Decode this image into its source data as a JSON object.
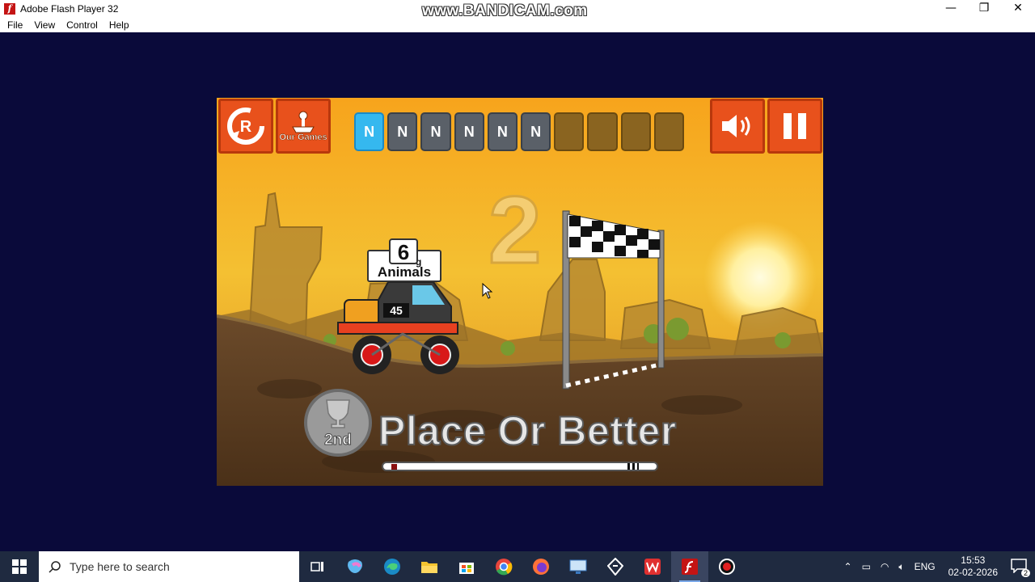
{
  "window": {
    "title": "Adobe Flash Player 32",
    "watermark": "www.BANDICAM.com",
    "controls": {
      "minimize": "—",
      "restore": "❐",
      "close": "✕"
    }
  },
  "menu": [
    "File",
    "View",
    "Control",
    "Help"
  ],
  "game": {
    "buttons": {
      "restart_letter": "R",
      "our_games": "Our Games",
      "sound": "sound-on",
      "pause": "pause"
    },
    "level_slots": [
      {
        "label": "N",
        "state": "active"
      },
      {
        "label": "N",
        "state": "done"
      },
      {
        "label": "N",
        "state": "done"
      },
      {
        "label": "N",
        "state": "done"
      },
      {
        "label": "N",
        "state": "done"
      },
      {
        "label": "N",
        "state": "done"
      },
      {
        "label": "",
        "state": "empty"
      },
      {
        "label": "",
        "state": "empty"
      },
      {
        "label": "",
        "state": "empty"
      },
      {
        "label": "",
        "state": "empty"
      }
    ],
    "countdown": "2",
    "animals_tag": {
      "count": "6",
      "under": "g",
      "label": "Animals"
    },
    "car_number": "45",
    "goal": {
      "place": "2nd",
      "text": "Place Or Better"
    },
    "race_progress": 0.02
  },
  "taskbar": {
    "search_placeholder": "Type here to search",
    "apps": [
      "task-view",
      "copilot",
      "edge",
      "file-explorer",
      "store",
      "chrome",
      "firefox",
      "remote-desktop",
      "vpn",
      "wps",
      "flash-player",
      "bandicam"
    ],
    "tray": {
      "language": "ENG",
      "time": "15:53",
      "date": "02-02-2026",
      "notifications": "2"
    }
  }
}
